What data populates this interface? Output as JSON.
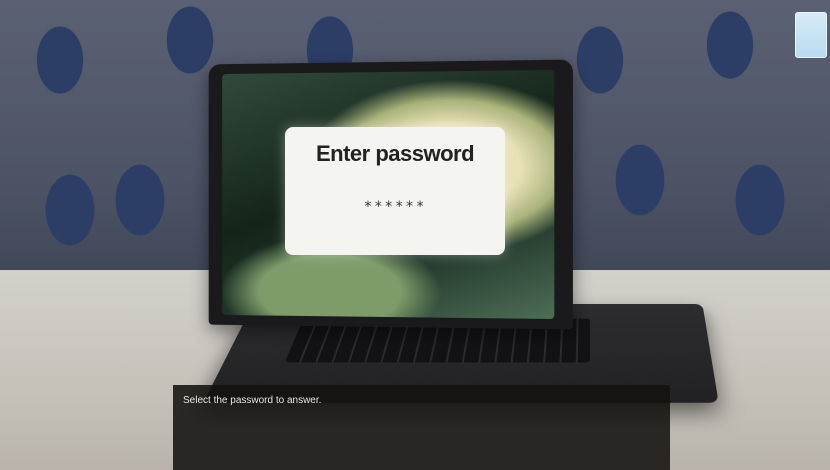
{
  "screen": {
    "dialog_title": "Enter password",
    "password_mask": "******"
  },
  "caption": {
    "text": "Select the password to answer."
  },
  "ui": {
    "menu_button_icon": "menu-square-icon"
  },
  "colors": {
    "wallpaper": "#4d5466",
    "table": "#c7c3bb",
    "dialog": "#f4f4f1",
    "caption_bg": "#141210",
    "menu_button": "#c6e3f4"
  }
}
